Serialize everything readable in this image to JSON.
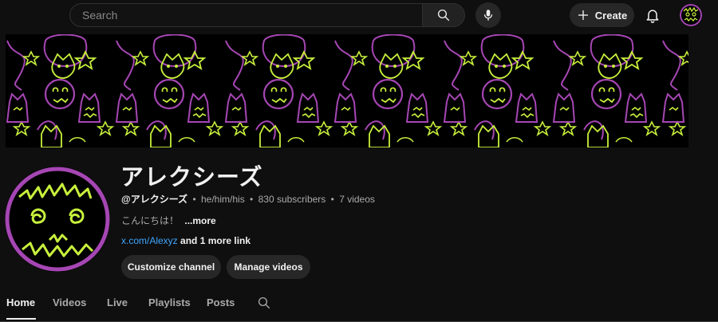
{
  "topbar": {
    "search_placeholder": "Search",
    "create_label": "Create"
  },
  "channel": {
    "name": "アレクシーズ",
    "handle": "@アレクシーズ",
    "pronouns": "he/him/his",
    "subscribers": "830 subscribers",
    "videos": "7 videos",
    "separator": "•",
    "description": "こんにちは！",
    "more_label": "...more",
    "link": "x.com/Alexyz",
    "more_links": "and 1 more link"
  },
  "buttons": {
    "customize": "Customize channel",
    "manage": "Manage videos"
  },
  "tabs": [
    {
      "label": "Home",
      "active": true
    },
    {
      "label": "Videos"
    },
    {
      "label": "Live"
    },
    {
      "label": "Playlists"
    },
    {
      "label": "Posts"
    }
  ],
  "colors": {
    "background": "#0f0f0f",
    "accent_link": "#3ea6ff",
    "banner_green": "#c8f03c",
    "banner_purple": "#a646b4"
  },
  "icons": [
    "search-icon",
    "mic-icon",
    "plus-icon",
    "bell-icon",
    "account-avatar",
    "tab-search-icon"
  ]
}
